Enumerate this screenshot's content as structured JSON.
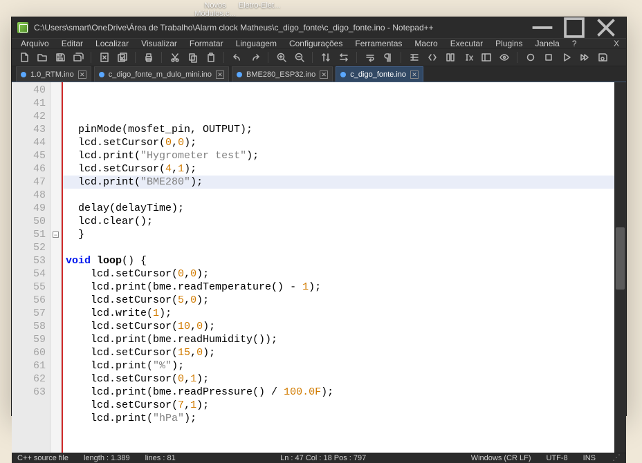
{
  "desktop": {
    "icons": [
      {
        "label": "Novos Módulos.c..."
      },
      {
        "label": "Eletro-Elet..."
      }
    ]
  },
  "title": "C:\\Users\\smart\\OneDrive\\Área de Trabalho\\Alarm clock Matheus\\c_digo_fonte\\c_digo_fonte.ino - Notepad++",
  "menubar": [
    "Arquivo",
    "Editar",
    "Localizar",
    "Visualizar",
    "Formatar",
    "Linguagem",
    "Configurações",
    "Ferramentas",
    "Macro",
    "Executar",
    "Plugins",
    "Janela",
    "?"
  ],
  "toolbar": [
    {
      "name": "new-file-icon",
      "icon": "file"
    },
    {
      "name": "open-folder-icon",
      "icon": "folder"
    },
    {
      "name": "save-icon",
      "icon": "save"
    },
    {
      "name": "save-all-icon",
      "icon": "saveall"
    },
    {
      "sep": true
    },
    {
      "name": "close-doc-icon",
      "icon": "closedoc"
    },
    {
      "name": "close-all-icon",
      "icon": "closeall"
    },
    {
      "sep": true
    },
    {
      "name": "print-icon",
      "icon": "print"
    },
    {
      "sep": true
    },
    {
      "name": "cut-icon",
      "icon": "cut"
    },
    {
      "name": "copy-icon",
      "icon": "copy"
    },
    {
      "name": "paste-icon",
      "icon": "paste"
    },
    {
      "sep": true
    },
    {
      "name": "undo-icon",
      "icon": "undo"
    },
    {
      "name": "redo-icon",
      "icon": "redo"
    },
    {
      "sep": true
    },
    {
      "name": "zoom-in-icon",
      "icon": "zoomin"
    },
    {
      "name": "zoom-out-icon",
      "icon": "zoomout"
    },
    {
      "sep": true
    },
    {
      "name": "sync-v-icon",
      "icon": "syncV"
    },
    {
      "name": "sync-h-icon",
      "icon": "syncH"
    },
    {
      "sep": true
    },
    {
      "name": "wordwrap-icon",
      "icon": "wrap"
    },
    {
      "name": "show-all-icon",
      "icon": "pilcrow"
    },
    {
      "sep": true
    },
    {
      "name": "indent-guide-icon",
      "icon": "indent"
    },
    {
      "name": "lang-icon",
      "icon": "code"
    },
    {
      "name": "doc-map-icon",
      "icon": "map"
    },
    {
      "name": "func-list-icon",
      "icon": "fx"
    },
    {
      "name": "folder-panel-icon",
      "icon": "panel"
    },
    {
      "name": "monitor-icon",
      "icon": "eye"
    },
    {
      "sep": true
    },
    {
      "name": "record-macro-icon",
      "icon": "record"
    },
    {
      "name": "stop-macro-icon",
      "icon": "stop"
    },
    {
      "name": "play-macro-icon",
      "icon": "play"
    },
    {
      "name": "run-multi-icon",
      "icon": "ff"
    },
    {
      "name": "save-macro-icon",
      "icon": "savemacro"
    }
  ],
  "tabs": [
    {
      "label": "1.0_RTM.ino",
      "active": false
    },
    {
      "label": "c_digo_fonte_m_dulo_mini.ino",
      "active": false
    },
    {
      "label": "BME280_ESP32.ino",
      "active": false
    },
    {
      "label": "c_digo_fonte.ino",
      "active": true
    }
  ],
  "code": {
    "first_line": 40,
    "highlight_line": 47,
    "fold_markers": {
      "51": "-"
    },
    "lines": [
      {
        "n": 40,
        "t": []
      },
      {
        "n": 41,
        "t": [
          [
            "ns",
            "  pinMode"
          ],
          [
            "p",
            "(mosfet_pin, OUTPUT);"
          ]
        ]
      },
      {
        "n": 42,
        "t": [
          [
            "ns",
            "  lcd.setCursor"
          ],
          [
            "p",
            "("
          ],
          [
            "num",
            "0"
          ],
          [
            "p",
            ","
          ],
          [
            "num",
            "0"
          ],
          [
            "p",
            ");"
          ]
        ]
      },
      {
        "n": 43,
        "t": [
          [
            "ns",
            "  lcd.print"
          ],
          [
            "p",
            "("
          ],
          [
            "str",
            "\"Hygrometer test\""
          ],
          [
            "p",
            ");"
          ]
        ]
      },
      {
        "n": 44,
        "t": [
          [
            "ns",
            "  lcd.setCursor"
          ],
          [
            "p",
            "("
          ],
          [
            "num",
            "4"
          ],
          [
            "p",
            ","
          ],
          [
            "num",
            "1"
          ],
          [
            "p",
            ");"
          ]
        ]
      },
      {
        "n": 45,
        "t": [
          [
            "ns",
            "  lcd.print"
          ],
          [
            "p",
            "("
          ],
          [
            "str",
            "\"BME280\""
          ],
          [
            "p",
            ");"
          ]
        ]
      },
      {
        "n": 46,
        "t": []
      },
      {
        "n": 47,
        "t": [
          [
            "ns",
            "  delay"
          ],
          [
            "p",
            "(delayTime);"
          ]
        ]
      },
      {
        "n": 48,
        "t": [
          [
            "ns",
            "  lcd.clear"
          ],
          [
            "p",
            "();"
          ]
        ]
      },
      {
        "n": 49,
        "t": [
          [
            "p",
            "  }"
          ]
        ]
      },
      {
        "n": 50,
        "t": []
      },
      {
        "n": 51,
        "t": [
          [
            "kw",
            "void"
          ],
          [
            "p",
            " "
          ],
          [
            "fn",
            "loop"
          ],
          [
            "p",
            "() {"
          ]
        ]
      },
      {
        "n": 52,
        "t": [
          [
            "ns",
            "    lcd.setCursor"
          ],
          [
            "p",
            "("
          ],
          [
            "num",
            "0"
          ],
          [
            "p",
            ","
          ],
          [
            "num",
            "0"
          ],
          [
            "p",
            ");"
          ]
        ]
      },
      {
        "n": 53,
        "t": [
          [
            "ns",
            "    lcd.print"
          ],
          [
            "p",
            "(bme.readTemperature() - "
          ],
          [
            "num",
            "1"
          ],
          [
            "p",
            ");"
          ]
        ]
      },
      {
        "n": 54,
        "t": [
          [
            "ns",
            "    lcd.setCursor"
          ],
          [
            "p",
            "("
          ],
          [
            "num",
            "5"
          ],
          [
            "p",
            ","
          ],
          [
            "num",
            "0"
          ],
          [
            "p",
            ");"
          ]
        ]
      },
      {
        "n": 55,
        "t": [
          [
            "ns",
            "    lcd.write"
          ],
          [
            "p",
            "("
          ],
          [
            "num",
            "1"
          ],
          [
            "p",
            ");"
          ]
        ]
      },
      {
        "n": 56,
        "t": [
          [
            "ns",
            "    lcd.setCursor"
          ],
          [
            "p",
            "("
          ],
          [
            "num",
            "10"
          ],
          [
            "p",
            ","
          ],
          [
            "num",
            "0"
          ],
          [
            "p",
            ");"
          ]
        ]
      },
      {
        "n": 57,
        "t": [
          [
            "ns",
            "    lcd.print"
          ],
          [
            "p",
            "(bme.readHumidity());"
          ]
        ]
      },
      {
        "n": 58,
        "t": [
          [
            "ns",
            "    lcd.setCursor"
          ],
          [
            "p",
            "("
          ],
          [
            "num",
            "15"
          ],
          [
            "p",
            ","
          ],
          [
            "num",
            "0"
          ],
          [
            "p",
            ");"
          ]
        ]
      },
      {
        "n": 59,
        "t": [
          [
            "ns",
            "    lcd.print"
          ],
          [
            "p",
            "("
          ],
          [
            "str",
            "\"%\""
          ],
          [
            "p",
            ");"
          ]
        ]
      },
      {
        "n": 60,
        "t": [
          [
            "ns",
            "    lcd.setCursor"
          ],
          [
            "p",
            "("
          ],
          [
            "num",
            "0"
          ],
          [
            "p",
            ","
          ],
          [
            "num",
            "1"
          ],
          [
            "p",
            ");"
          ]
        ]
      },
      {
        "n": 61,
        "t": [
          [
            "ns",
            "    lcd.print"
          ],
          [
            "p",
            "(bme.readPressure() / "
          ],
          [
            "num",
            "100.0F"
          ],
          [
            "p",
            ");"
          ]
        ]
      },
      {
        "n": 62,
        "t": [
          [
            "ns",
            "    lcd.setCursor"
          ],
          [
            "p",
            "("
          ],
          [
            "num",
            "7"
          ],
          [
            "p",
            ","
          ],
          [
            "num",
            "1"
          ],
          [
            "p",
            ");"
          ]
        ]
      },
      {
        "n": 63,
        "t": [
          [
            "ns",
            "    lcd.print"
          ],
          [
            "p",
            "("
          ],
          [
            "str",
            "\"hPa\""
          ],
          [
            "p",
            ");"
          ]
        ]
      }
    ]
  },
  "status": {
    "type": "C++ source file",
    "length": "length : 1.389",
    "lines": "lines : 81",
    "pos": "Ln : 47   Col : 18   Pos : 797",
    "eol": "Windows (CR LF)",
    "enc": "UTF-8",
    "ovr": "INS"
  }
}
